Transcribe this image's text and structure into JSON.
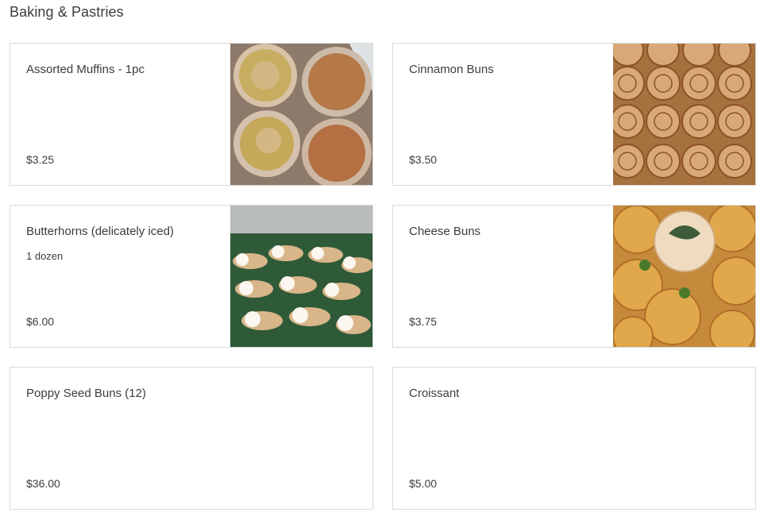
{
  "section": {
    "title": "Baking & Pastries"
  },
  "items": [
    {
      "name": "Assorted Muffins - 1pc",
      "description": "",
      "price": "$3.25",
      "image": "muffins-photo"
    },
    {
      "name": "Cinnamon Buns",
      "description": "",
      "price": "$3.50",
      "image": "cinnamon-buns-photo"
    },
    {
      "name": "Butterhorns (delicately iced)",
      "description": "1 dozen",
      "price": "$6.00",
      "image": "butterhorns-photo"
    },
    {
      "name": "Cheese Buns",
      "description": "",
      "price": "$3.75",
      "image": "cheese-buns-photo"
    },
    {
      "name": "Poppy Seed Buns (12)",
      "description": "",
      "price": "$36.00",
      "image": ""
    },
    {
      "name": "Croissant",
      "description": "",
      "price": "$5.00",
      "image": ""
    }
  ],
  "colors": {
    "text": "#3c3c3c",
    "border": "#d9d9d9",
    "background": "#ffffff"
  }
}
